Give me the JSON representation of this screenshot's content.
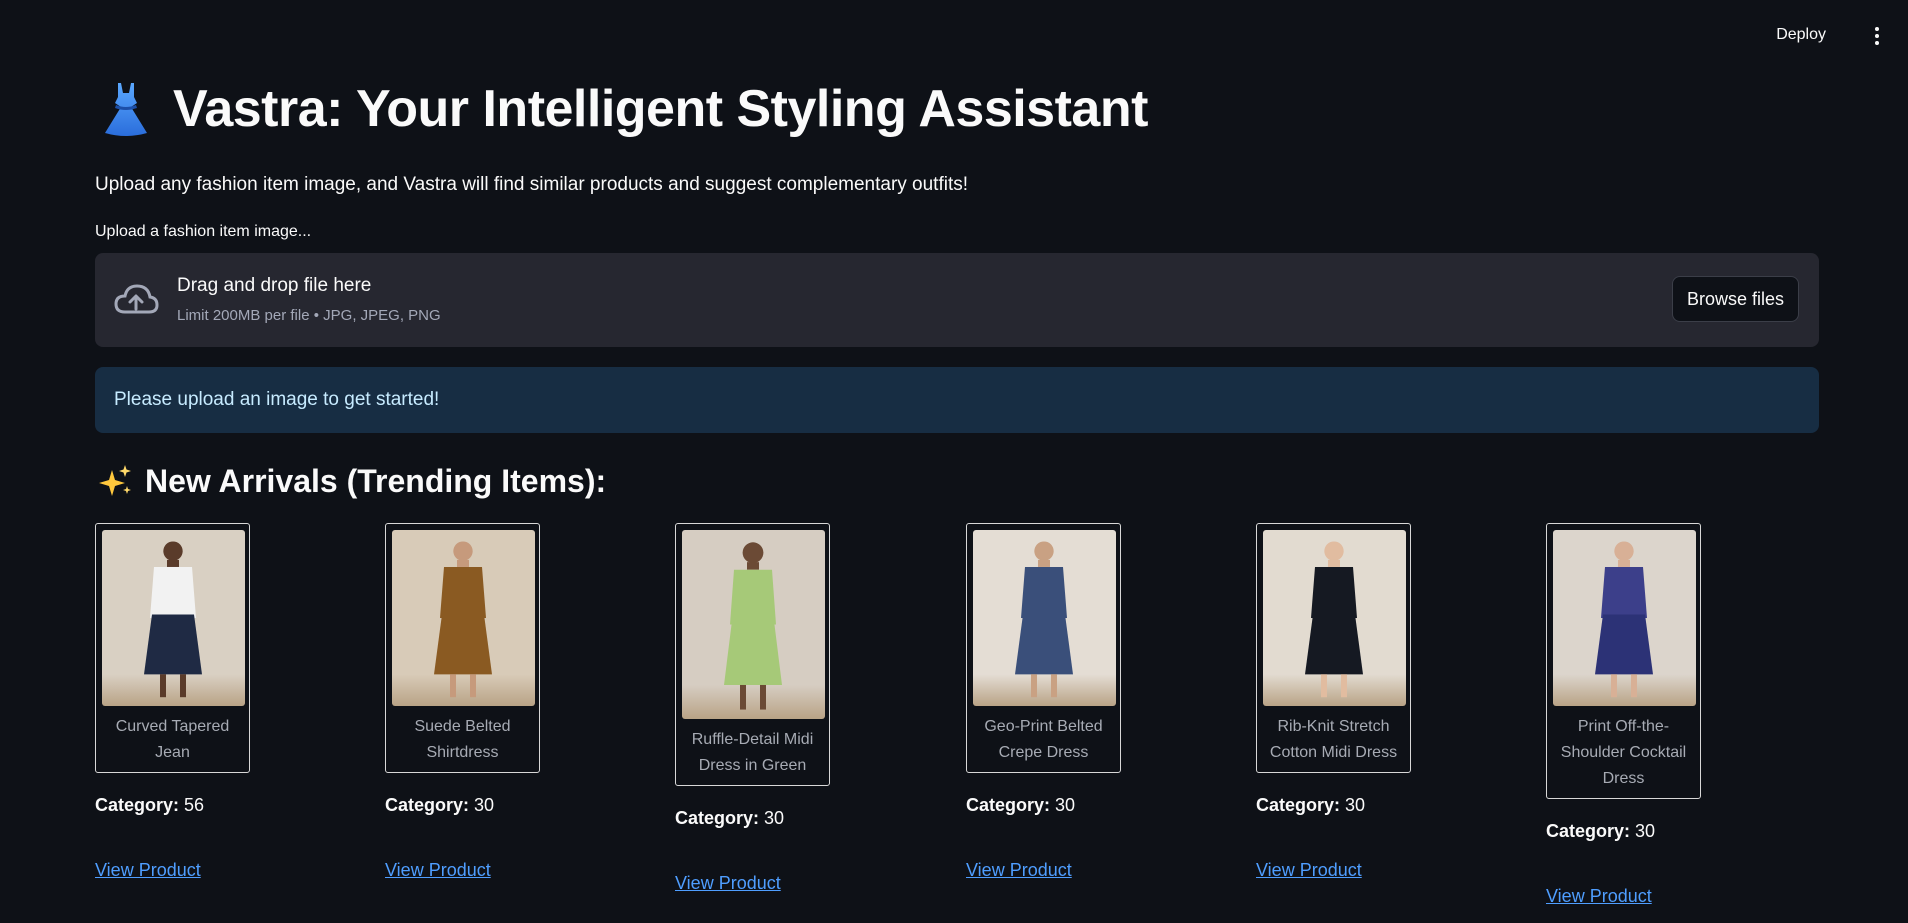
{
  "header": {
    "deploy_label": "Deploy",
    "menu_icon": "vertical-dots-icon"
  },
  "page": {
    "title": "Vastra: Your Intelligent Styling Assistant",
    "title_icon": "dress-icon",
    "subtitle": "Upload any fashion item image, and Vastra will find similar products and suggest complementary outfits!"
  },
  "uploader": {
    "label": "Upload a fashion item image...",
    "drop_title": "Drag and drop file here",
    "limit_text": "Limit 200MB per file • JPG, JPEG, PNG",
    "browse_label": "Browse files",
    "icon": "cloud-upload-icon"
  },
  "info": {
    "message": "Please upload an image to get started!"
  },
  "new_arrivals": {
    "heading": "New Arrivals (Trending Items):",
    "heading_icon": "sparkles-icon",
    "category_label": "Category:",
    "link_label": "View Product",
    "items": [
      {
        "name": "Curved Tapered Jean",
        "category": "56",
        "image_colors": {
          "bg": "#d9d0c3",
          "top": "#f2f2f2",
          "bottom": "#1f2a44",
          "skin": "#5a3b2a"
        }
      },
      {
        "name": "Suede Belted Shirtdress",
        "category": "30",
        "image_colors": {
          "bg": "#d8cbb8",
          "top": "#8a5a22",
          "bottom": "#8a5a22",
          "skin": "#c69a7c"
        }
      },
      {
        "name": "Ruffle-Detail Midi Dress in Green",
        "category": "30",
        "image_colors": {
          "bg": "#d6cdc2",
          "top": "#a6c978",
          "bottom": "#a6c978",
          "skin": "#6b4a35"
        }
      },
      {
        "name": "Geo-Print Belted Crepe Dress",
        "category": "30",
        "image_colors": {
          "bg": "#e4ddd4",
          "top": "#3a4f7a",
          "bottom": "#3a4f7a",
          "skin": "#c9a183"
        }
      },
      {
        "name": "Rib-Knit Stretch Cotton Midi Dress",
        "category": "30",
        "image_colors": {
          "bg": "#e2dbd0",
          "top": "#151922",
          "bottom": "#151922",
          "skin": "#e1bca0"
        }
      },
      {
        "name": "Print Off-the-Shoulder Cocktail Dress",
        "category": "30",
        "image_colors": {
          "bg": "#dcd5cc",
          "top": "#3c3f8a",
          "bottom": "#2c3276",
          "skin": "#d8b096"
        }
      }
    ]
  }
}
